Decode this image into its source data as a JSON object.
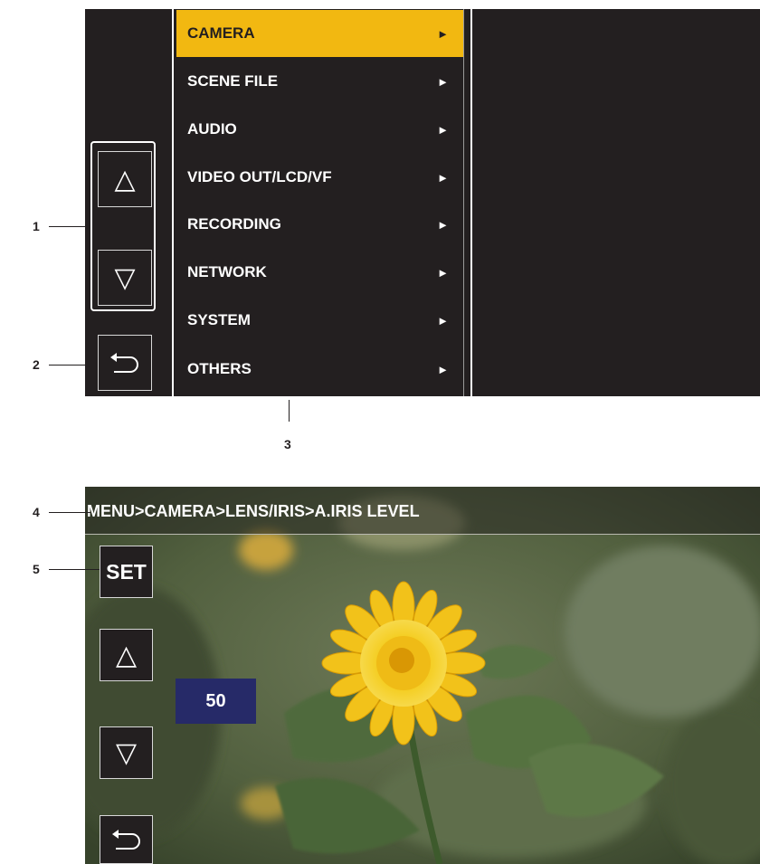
{
  "top_screen": {
    "menu_items": [
      {
        "label": "CAMERA",
        "arrow": "►",
        "selected": true
      },
      {
        "label": "SCENE FILE",
        "arrow": "►"
      },
      {
        "label": "AUDIO",
        "arrow": "►"
      },
      {
        "label": "VIDEO OUT/LCD/VF",
        "arrow": "►"
      },
      {
        "label": "RECORDING",
        "arrow": "►"
      },
      {
        "label": "NETWORK",
        "arrow": "►"
      },
      {
        "label": "SYSTEM",
        "arrow": "►"
      },
      {
        "label": "OTHERS",
        "arrow": "►"
      }
    ],
    "up_icon": "△",
    "down_icon": "▽",
    "back_icon": "return-arrow-icon"
  },
  "callouts": {
    "c1": "1",
    "c2": "2",
    "c3": "3",
    "c4": "4",
    "c5": "5"
  },
  "bottom_screen": {
    "breadcrumb": "MENU>CAMERA>LENS/IRIS>A.IRIS LEVEL",
    "set_label": "SET",
    "up_icon": "△",
    "down_icon": "▽",
    "value": "50",
    "back_icon": "return-arrow-icon"
  },
  "colors": {
    "screen_bg": "#231f20",
    "highlight": "#f2b811",
    "value_bg": "#262a68"
  }
}
